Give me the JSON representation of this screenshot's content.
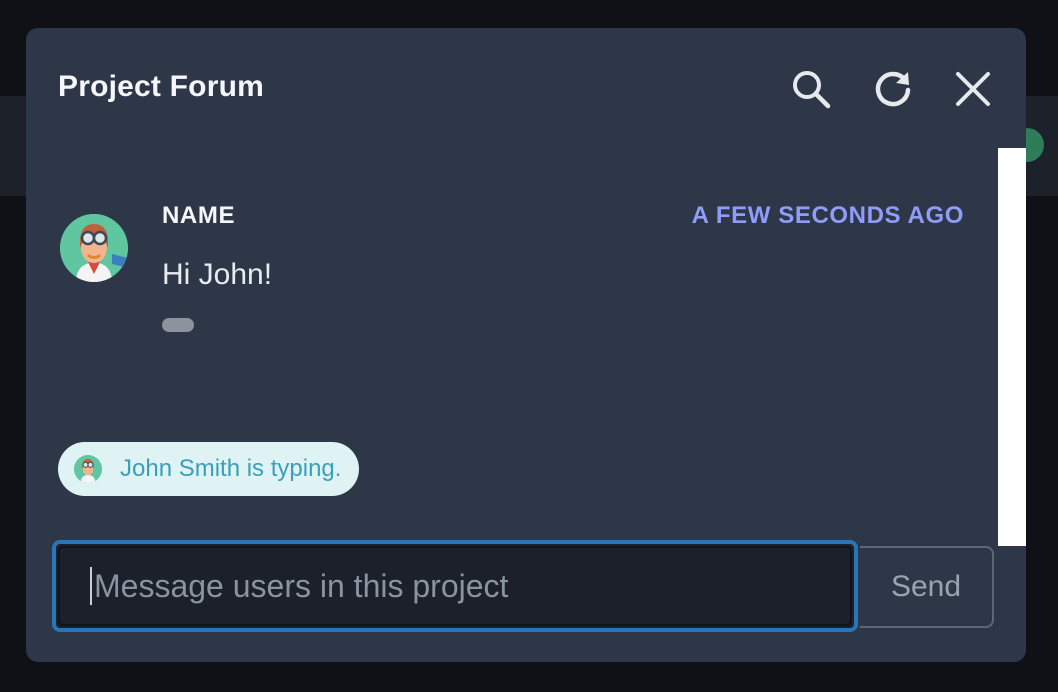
{
  "panel": {
    "title": "Project Forum"
  },
  "header": {
    "icons": [
      "search-icon",
      "refresh-icon",
      "close-icon"
    ]
  },
  "messages": [
    {
      "author": "NAME",
      "time": "A FEW SECONDS AGO",
      "body": "Hi John!"
    }
  ],
  "typing": {
    "text": "John Smith is typing."
  },
  "composer": {
    "input_value": "",
    "placeholder": "Message users in this project",
    "send_label": "Send"
  },
  "colors": {
    "panel_bg": "#2d3748",
    "accent_time": "#8f9cf8",
    "input_focus": "#2a74b8",
    "typing_bg": "#dff3f5",
    "typing_text": "#3a9fb8"
  }
}
